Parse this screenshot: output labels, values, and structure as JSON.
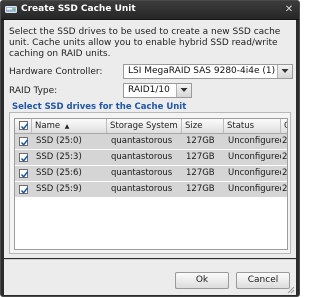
{
  "window": {
    "title": "Create SSD Cache Unit",
    "close_glyph": "✕"
  },
  "intro_text": "Select the SSD drives to be used to create a new SSD cache unit. Cache units allow you to enable hybrid SSD read/write caching on RAID units.",
  "hardware_controller": {
    "label": "Hardware Controller:",
    "value": "LSI MegaRAID SAS 9280-4i4e (1)"
  },
  "raid_type": {
    "label": "RAID Type:",
    "value": "RAID1/10"
  },
  "drives_group": {
    "title": "Select SSD drives for the Cache Unit",
    "columns": {
      "name": "Name",
      "sort_glyph": "▲",
      "storage_system": "Storage System",
      "size": "Size",
      "status": "Status",
      "extra": "C"
    },
    "rows": [
      {
        "name": "SSD (25:0)",
        "storage_system": "quantastorous",
        "size": "127GB",
        "status": "Unconfigured(g...",
        "extra": "2",
        "checked": true
      },
      {
        "name": "SSD (25:3)",
        "storage_system": "quantastorous",
        "size": "127GB",
        "status": "Unconfigured(g...",
        "extra": "2",
        "checked": true
      },
      {
        "name": "SSD (25:6)",
        "storage_system": "quantastorous",
        "size": "127GB",
        "status": "Unconfigured(g...",
        "extra": "2",
        "checked": true
      },
      {
        "name": "SSD (25:9)",
        "storage_system": "quantastorous",
        "size": "127GB",
        "status": "Unconfigured(g...",
        "extra": "2",
        "checked": true
      }
    ]
  },
  "buttons": {
    "ok": "Ok",
    "cancel": "Cancel"
  },
  "icons": {
    "title": "drive-icon",
    "close": "close-icon",
    "dropdown": "chevron-down-icon",
    "check": "checkmark-icon"
  },
  "colors": {
    "titlebar": "#2b2b2b",
    "group_title": "#1f56a8",
    "selected_row": "#d5d5d5",
    "check": "#1f56a8"
  }
}
